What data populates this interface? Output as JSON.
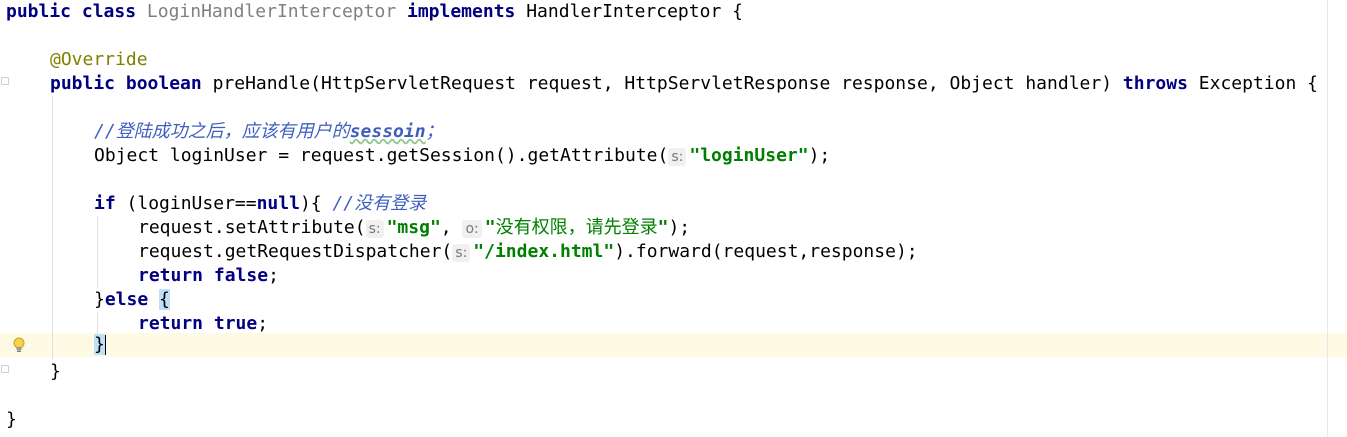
{
  "code": {
    "l1": {
      "kw1": "public",
      "kw2": "class",
      "class_name": "LoginHandlerInterceptor",
      "kw3": "implements",
      "iface": "HandlerInterceptor",
      "brace": "{"
    },
    "l2": {
      "annotation": "@Override"
    },
    "l3": {
      "kw1": "public",
      "kw2": "boolean",
      "rest": "preHandle(HttpServletRequest request, HttpServletResponse response, Object handler)",
      "kw3": "throws",
      "tail": "Exception {"
    },
    "l4": {
      "comment_prefix": "//",
      "comment_cjk": "登陆成功之后，应该有用户的",
      "comment_word": "sessoin",
      "comment_end": "；"
    },
    "l5": {
      "pre": "Object loginUser = request.getSession().getAttribute(",
      "hint": "s:",
      "str": "\"loginUser\"",
      "post": ");"
    },
    "l6": {
      "kw": "if",
      "pre": "(loginUser==",
      "kw_null": "null",
      "post": "){",
      "comment_prefix": "//",
      "comment_cjk": "没有登录"
    },
    "l7": {
      "pre": "request.setAttribute(",
      "hint1": "s:",
      "str1": "\"msg\"",
      "sep": ",",
      "hint2": "o:",
      "q1": "\"",
      "cjk": "没有权限，请先登录",
      "q2": "\"",
      "post": ");"
    },
    "l8": {
      "pre": "request.getRequestDispatcher(",
      "hint": "s:",
      "str": "\"/index.html\"",
      "post": ").forward(request,response);"
    },
    "l9": {
      "kw1": "return",
      "kw2": "false",
      "post": ";"
    },
    "l10": {
      "pre": "}",
      "kw": "else",
      "brace": "{"
    },
    "l11": {
      "kw1": "return",
      "kw2": "true",
      "post": ";"
    },
    "l12": {
      "brace": "}"
    },
    "l13": {
      "brace": "}"
    },
    "l14": {
      "brace": "}"
    }
  },
  "colors": {
    "keyword": "#000080",
    "string": "#008000",
    "comment": "#3f5fbf",
    "annotation": "#808000",
    "caret_row": "#fffae3",
    "brace_match": "#bfe0f6"
  },
  "icons": {
    "intention": "lightbulb-icon"
  }
}
